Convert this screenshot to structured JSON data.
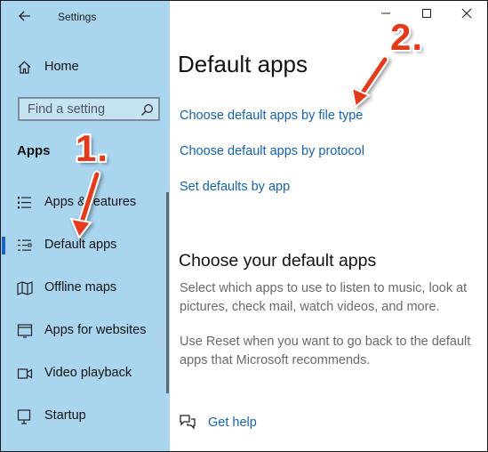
{
  "window": {
    "title": "Settings",
    "controls": {
      "minimize": "minimize-icon",
      "maximize": "maximize-icon",
      "close": "close-icon"
    }
  },
  "sidebar": {
    "back_icon": "back-arrow-icon",
    "home_label": "Home",
    "search_placeholder": "Find a setting",
    "section_heading": "Apps",
    "items": [
      {
        "label": "Apps & features",
        "icon": "apps-features-icon",
        "selected": false
      },
      {
        "label": "Default apps",
        "icon": "default-apps-icon",
        "selected": true
      },
      {
        "label": "Offline maps",
        "icon": "map-icon",
        "selected": false
      },
      {
        "label": "Apps for websites",
        "icon": "apps-websites-icon",
        "selected": false
      },
      {
        "label": "Video playback",
        "icon": "video-icon",
        "selected": false
      },
      {
        "label": "Startup",
        "icon": "startup-icon",
        "selected": false
      }
    ]
  },
  "main": {
    "title": "Default apps",
    "links": [
      "Choose default apps by file type",
      "Choose default apps by protocol",
      "Set defaults by app"
    ],
    "subheading": "Choose your default apps",
    "description1": "Select which apps to use to listen to music, look at pictures, check mail, watch videos, and more.",
    "description2": "Use Reset when you want to go back to the default apps that Microsoft recommends.",
    "help_label": "Get help"
  },
  "annotations": {
    "step1": "1.",
    "step2": "2."
  },
  "colors": {
    "sidebar_bg": "#a9d5ee",
    "link": "#1563ac",
    "annotation": "#e43a1b",
    "selection_marker": "#1d63c4"
  }
}
